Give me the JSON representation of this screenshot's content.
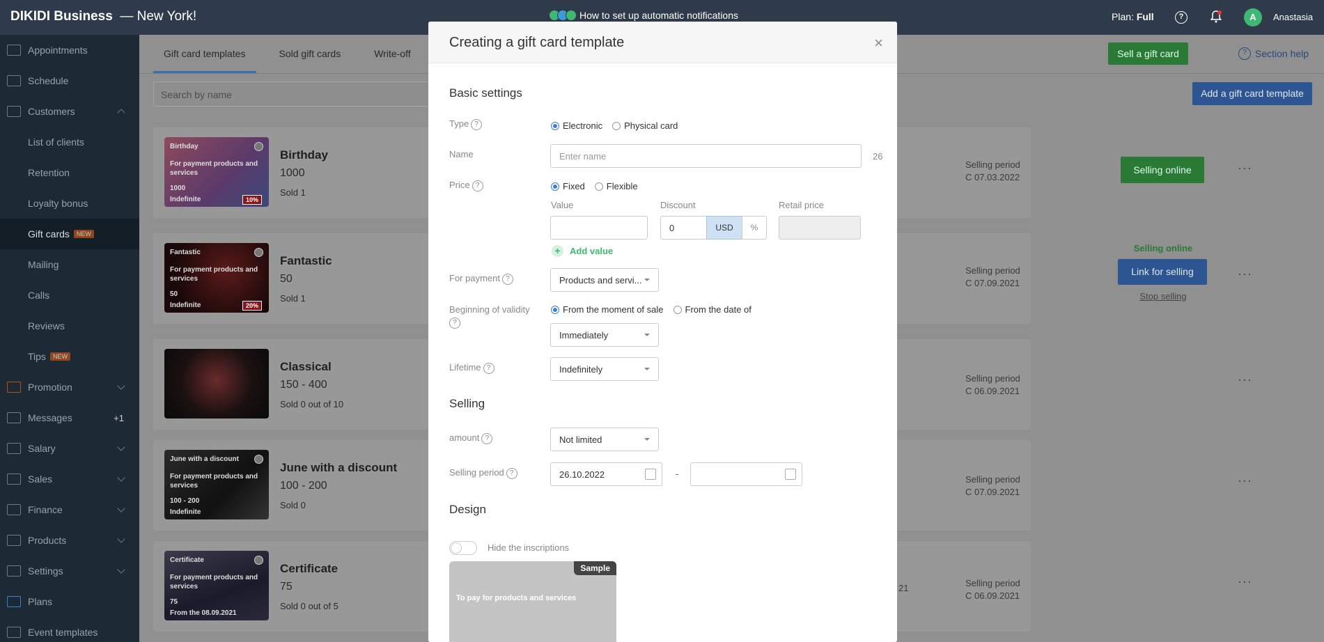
{
  "header": {
    "brand": "DIKIDI Business",
    "location": "— New York!",
    "notification_text": "How to set up automatic notifications",
    "plan_label": "Plan:",
    "plan_value": "Full",
    "user_initial": "A",
    "user_name": "Anastasia"
  },
  "sidebar": {
    "items": [
      {
        "label": "Appointments"
      },
      {
        "label": "Schedule"
      },
      {
        "label": "Customers"
      },
      {
        "label": "List of clients"
      },
      {
        "label": "Retention"
      },
      {
        "label": "Loyalty bonus"
      },
      {
        "label": "Gift cards",
        "badge": "NEW"
      },
      {
        "label": "Mailing"
      },
      {
        "label": "Calls"
      },
      {
        "label": "Reviews"
      },
      {
        "label": "Tips",
        "badge": "NEW"
      },
      {
        "label": "Promotion"
      },
      {
        "label": "Messages",
        "count": "+1"
      },
      {
        "label": "Salary"
      },
      {
        "label": "Sales"
      },
      {
        "label": "Finance"
      },
      {
        "label": "Products"
      },
      {
        "label": "Settings"
      },
      {
        "label": "Plans"
      },
      {
        "label": "Event templates"
      }
    ]
  },
  "main": {
    "tabs": [
      "Gift card templates",
      "Sold gift cards",
      "Write-off"
    ],
    "search_placeholder": "Search by name",
    "sell_button": "Sell a gift card",
    "help_link": "Section help",
    "add_button": "Add a gift card template",
    "cards": [
      {
        "thumb_title": "Birthday",
        "thumb_desc": "For payment products and services",
        "thumb_value": "1000",
        "thumb_validity": "Indefinite",
        "thumb_pct": "10%",
        "name": "Birthday",
        "value": "1000",
        "sold": "Sold 1",
        "period_label": "Selling period",
        "period": "C 07.03.2022",
        "action": "Selling online"
      },
      {
        "thumb_title": "Fantastic",
        "thumb_desc": "For payment products and services",
        "thumb_value": "50",
        "thumb_validity": "Indefinite",
        "thumb_pct": "20%",
        "name": "Fantastic",
        "value": "50",
        "sold": "Sold 1",
        "period_label": "Selling period",
        "period": "C 07.09.2021",
        "status": "Selling online",
        "action": "Link for selling",
        "stop": "Stop selling"
      },
      {
        "name": "Classical",
        "value": "150 - 400",
        "sold": "Sold 0 out of 10",
        "period_label": "Selling period",
        "period": "C 06.09.2021"
      },
      {
        "thumb_title": "June with a discount",
        "thumb_desc": "For payment products and services",
        "thumb_value": "100 - 200",
        "thumb_validity": "Indefinite",
        "name": "June with a discount",
        "value": "100 - 200",
        "sold": "Sold 0",
        "period_label": "Selling period",
        "period": "C 07.09.2021"
      },
      {
        "thumb_title": "Certificate",
        "thumb_desc": "For payment products and services",
        "thumb_value": "75",
        "thumb_validity": "From the 08.09.2021",
        "name": "Certificate",
        "value": "75",
        "sold": "Sold 0 out of 5",
        "period_label": "Selling period",
        "period": "C 06.09.2021",
        "extra_partial": "21"
      }
    ]
  },
  "modal": {
    "title": "Creating a gift card template",
    "basic_settings": "Basic settings",
    "type_label": "Type",
    "type_options": [
      "Electronic",
      "Physical card"
    ],
    "name_label": "Name",
    "name_placeholder": "Enter name",
    "name_counter": "26",
    "price_label": "Price",
    "price_options": [
      "Fixed",
      "Flexible"
    ],
    "value_label": "Value",
    "discount_label": "Discount",
    "discount_value": "0",
    "currency_usd": "USD",
    "currency_pct": "%",
    "retail_label": "Retail price",
    "add_value": "Add value",
    "payment_label": "For payment",
    "payment_value": "Products and servi...",
    "validity_label": "Beginning of validity",
    "validity_options": [
      "From the moment of sale",
      "From the date of"
    ],
    "validity_select": "Immediately",
    "lifetime_label": "Lifetime",
    "lifetime_value": "Indefinitely",
    "selling_section": "Selling",
    "amount_label": "amount",
    "amount_value": "Not limited",
    "period_label": "Selling period",
    "period_start": "26.10.2022",
    "period_dash": "-",
    "design_section": "Design",
    "hide_inscriptions": "Hide the inscriptions",
    "sample_badge": "Sample",
    "sample_text": "To pay for products and services"
  },
  "colors": {
    "accent_blue": "#3a7fd5",
    "green": "#3eb872",
    "sidebar_bg": "#1d2a35",
    "header_bg": "#2f3b4b"
  }
}
